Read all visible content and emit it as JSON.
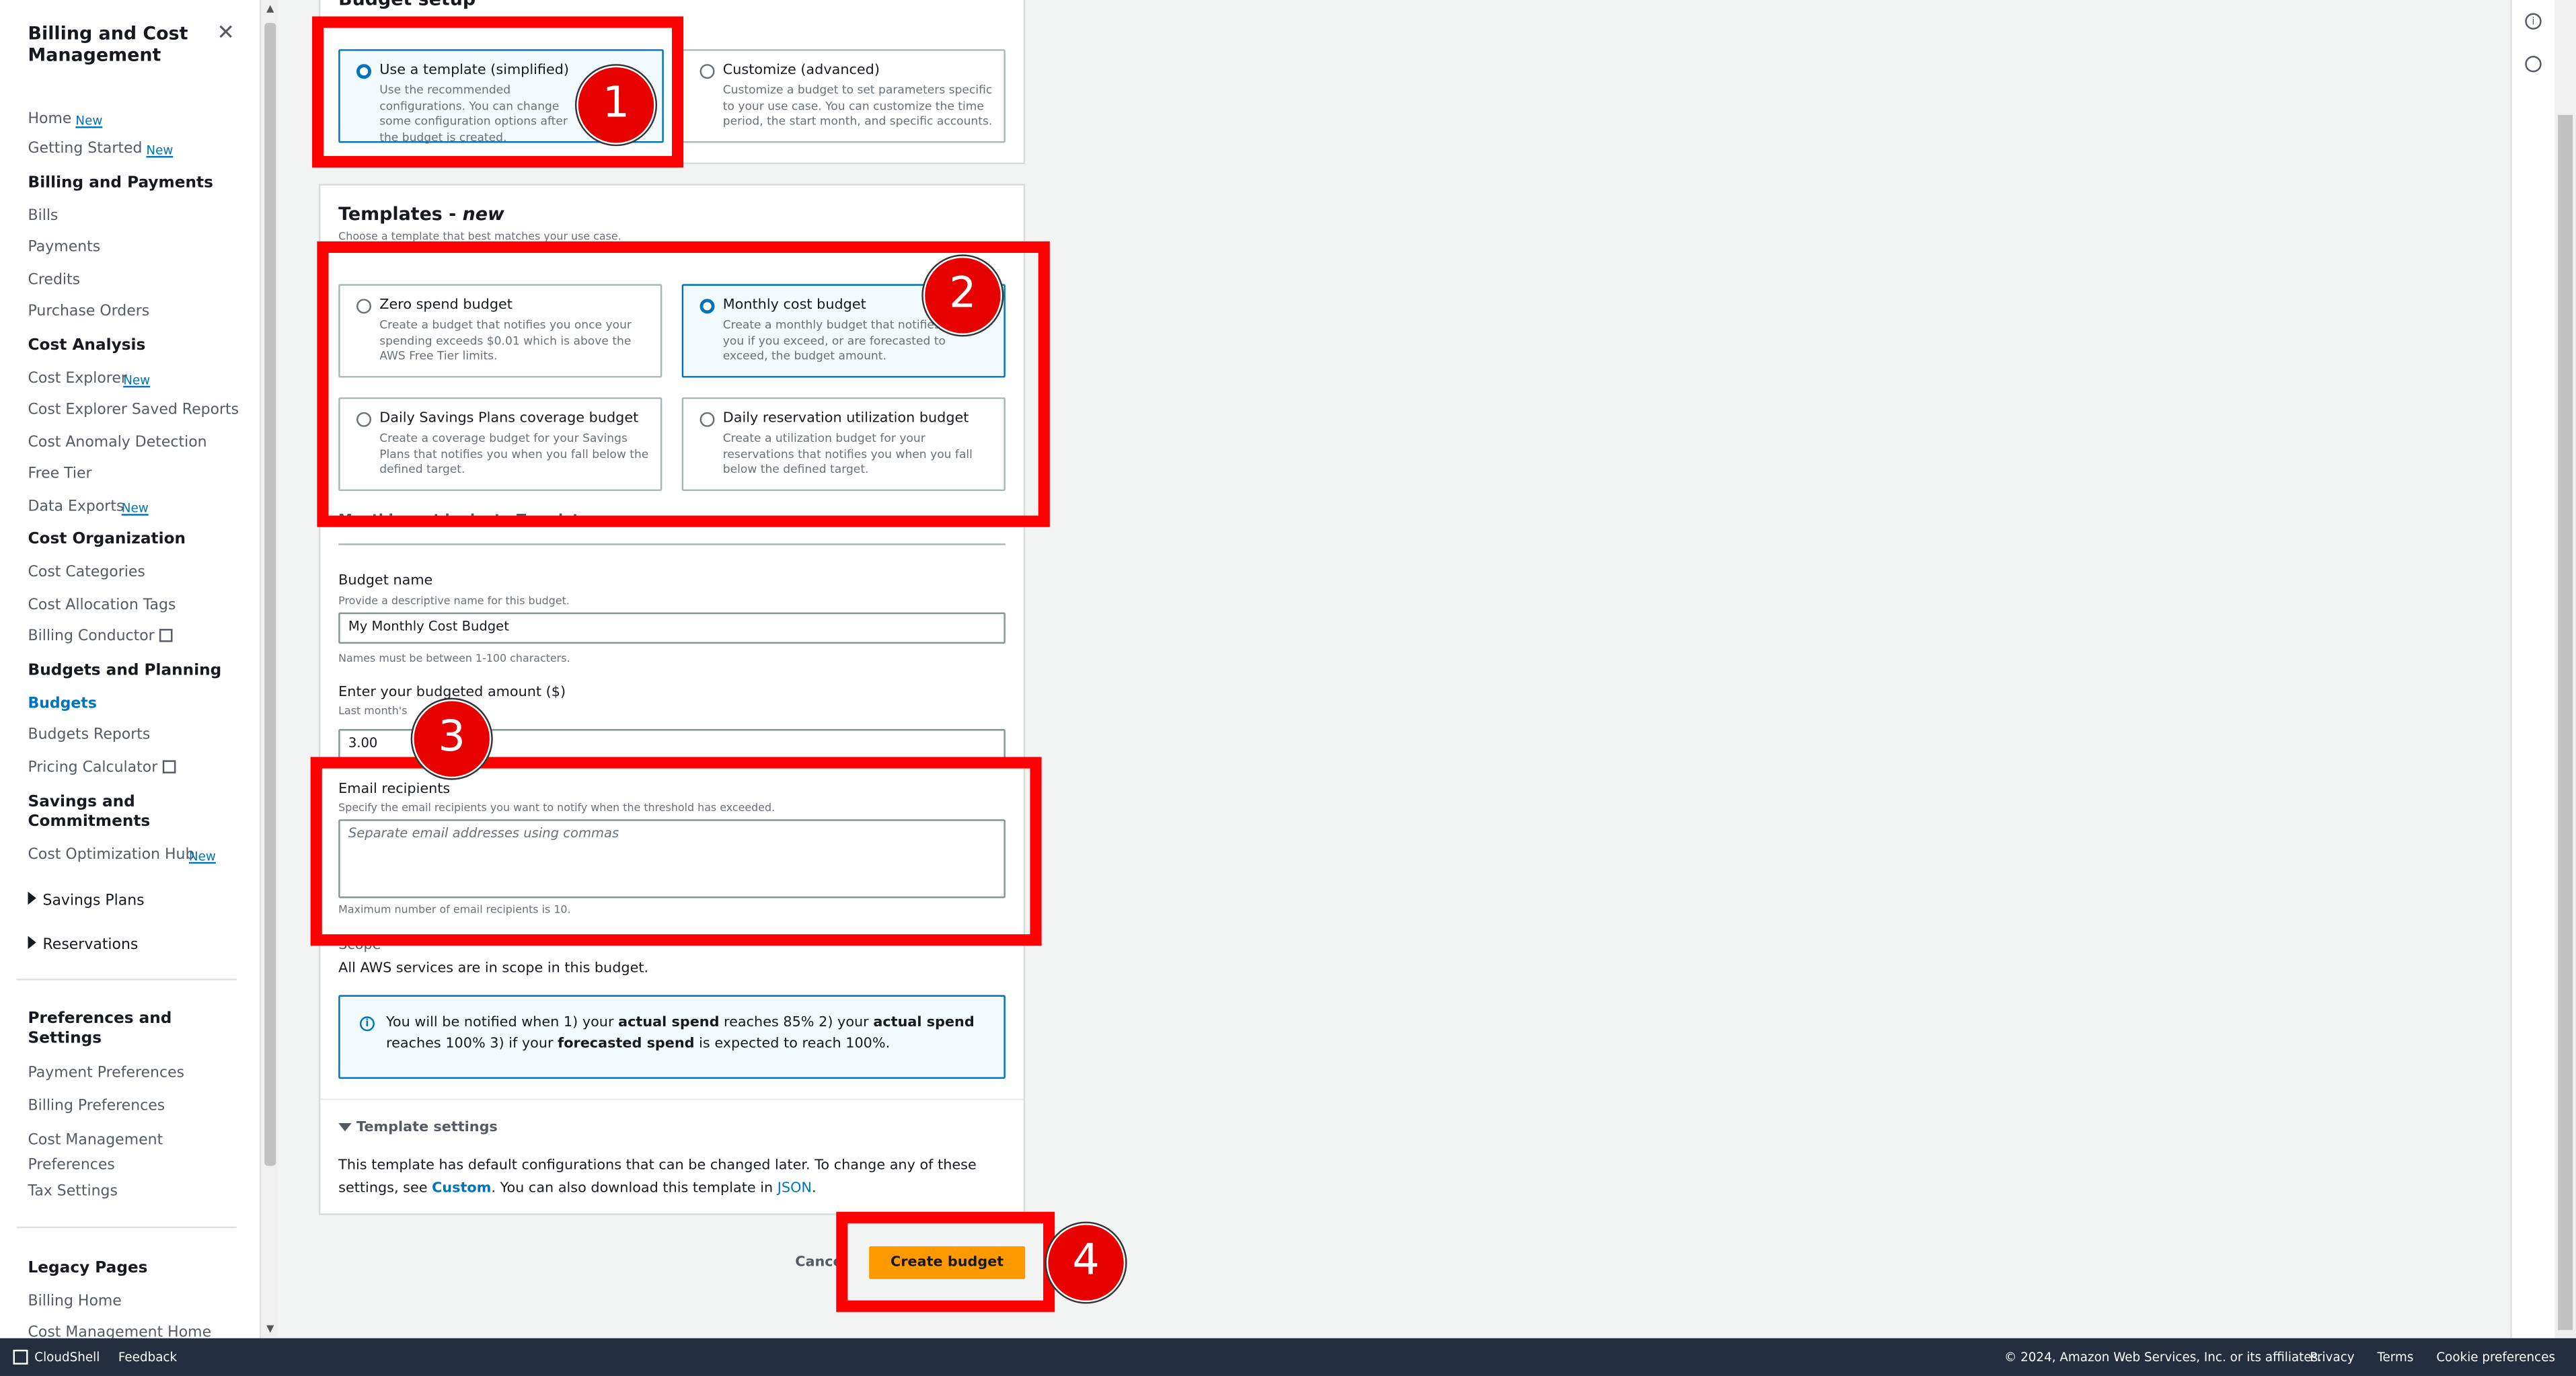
{
  "sidebar": {
    "title": "Billing and Cost Management",
    "new_badge": "New",
    "items": {
      "home": "Home",
      "getting_started": "Getting Started",
      "billing_payments": "Billing and Payments",
      "bills": "Bills",
      "payments": "Payments",
      "credits": "Credits",
      "purchase_orders": "Purchase Orders",
      "cost_analysis": "Cost Analysis",
      "cost_explorer": "Cost Explorer",
      "cost_explorer_saved": "Cost Explorer Saved Reports",
      "cost_anomaly": "Cost Anomaly Detection",
      "free_tier": "Free Tier",
      "data_exports": "Data Exports",
      "cost_organization": "Cost Organization",
      "cost_categories": "Cost Categories",
      "cost_allocation_tags": "Cost Allocation Tags",
      "billing_conductor": "Billing Conductor",
      "budgets_planning": "Budgets and Planning",
      "budgets": "Budgets",
      "budgets_reports": "Budgets Reports",
      "pricing_calculator": "Pricing Calculator",
      "savings_commitments": "Savings and Commitments",
      "cost_optimization_hub": "Cost Optimization Hub",
      "savings_plans": "Savings Plans",
      "reservations": "Reservations",
      "preferences_settings": "Preferences and Settings",
      "payment_preferences": "Payment Preferences",
      "billing_preferences": "Billing Preferences",
      "cost_management_preferences": "Cost Management Preferences",
      "tax_settings": "Tax Settings",
      "legacy_pages": "Legacy Pages",
      "billing_home": "Billing Home",
      "cost_management_home": "Cost Management Home"
    }
  },
  "budget_setup": {
    "heading": "Budget setup",
    "template": {
      "title": "Use a template (simplified)",
      "desc": "Use the recommended configurations. You can change some configuration options after the budget is created."
    },
    "customize": {
      "title": "Customize (advanced)",
      "desc": "Customize a budget to set parameters specific to your use case. You can customize the time period, the start month, and specific accounts."
    }
  },
  "templates": {
    "heading": "Templates - ",
    "heading_new": "new",
    "sub": "Choose a template that best matches your use case.",
    "zero": {
      "title": "Zero spend budget",
      "desc": "Create a budget that notifies you once your spending exceeds $0.01 which is above the AWS Free Tier limits."
    },
    "monthly": {
      "title": "Monthly cost budget",
      "desc": "Create a monthly budget that notifies you if you exceed, or are forecasted to exceed, the budget amount."
    },
    "savings": {
      "title": "Daily Savings Plans coverage budget",
      "desc": "Create a coverage budget for your Savings Plans that notifies you when you fall below the defined target."
    },
    "reservation": {
      "title": "Daily reservation utilization budget",
      "desc": "Create a utilization budget for your reservations that notifies you when you fall below the defined target."
    },
    "section_title": "Monthly cost budget - Template"
  },
  "form": {
    "budget_name_label": "Budget name",
    "budget_name_hint": "Provide a descriptive name for this budget.",
    "budget_name_value": "My Monthly Cost Budget",
    "budget_name_constraint": "Names must be between 1-100 characters.",
    "amount_label": "Enter your budgeted amount ($)",
    "amount_hint": "Last month's",
    "amount_value": "3.00",
    "email_label": "Email recipients",
    "email_hint": "Specify the email recipients you want to notify when the threshold has exceeded.",
    "email_placeholder": "Separate email addresses using commas",
    "email_constraint": "Maximum number of email recipients is 10.",
    "scope_label": "Scope",
    "scope_text": "All AWS services are in scope in this budget."
  },
  "info_box": {
    "t1": "You will be notified when 1) your ",
    "b1": "actual spend",
    "t2": " reaches 85% 2) your ",
    "b2": "actual spend",
    "t3": "reaches 100% 3) if your ",
    "b3": "forecasted spend",
    "t4": " is expected to reach 100%."
  },
  "template_settings": {
    "title": "Template settings",
    "line1": "This template has default configurations that can be changed later. To change any of these",
    "line2a": "settings, see ",
    "custom_link": "Custom",
    "line2b": ". You can also download this template in ",
    "json_link": "JSON",
    "line2c": "."
  },
  "actions": {
    "cancel": "Cancel",
    "create": "Create budget"
  },
  "annotations": [
    "1",
    "2",
    "3",
    "4"
  ],
  "footer": {
    "cloudshell": "CloudShell",
    "feedback": "Feedback",
    "copyright": "© 2024, Amazon Web Services, Inc. or its affiliates.",
    "privacy": "Privacy",
    "terms": "Terms",
    "cookie": "Cookie preferences"
  },
  "colors": {
    "accent": "#0073bb",
    "primary_button": "#ff9900",
    "annotation": "#ff0000",
    "footer_bg": "#232f3e"
  },
  "icons": [
    "close-icon",
    "external-link-icon",
    "info-icon",
    "caret-right-icon",
    "caret-down-icon",
    "cloudshell-icon"
  ]
}
